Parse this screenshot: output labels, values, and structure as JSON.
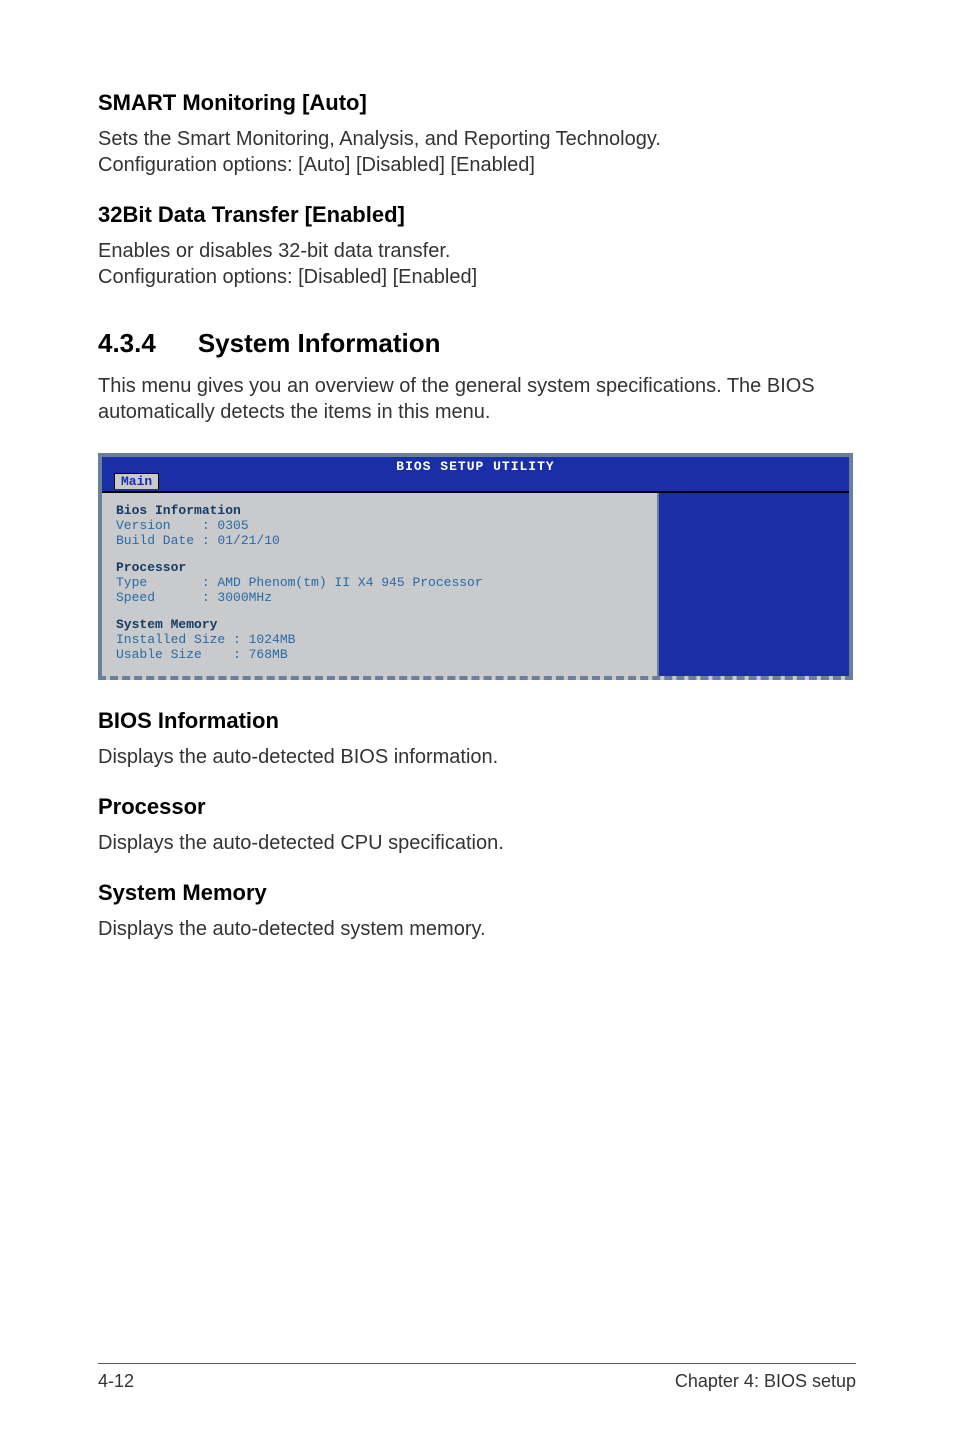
{
  "section1": {
    "heading": "SMART Monitoring [Auto]",
    "p1": "Sets the Smart Monitoring, Analysis, and Reporting Technology.",
    "p2": "Configuration options: [Auto] [Disabled] [Enabled]"
  },
  "section2": {
    "heading": "32Bit Data Transfer [Enabled]",
    "p1": "Enables or disables 32-bit data transfer.",
    "p2": "Configuration options: [Disabled] [Enabled]"
  },
  "section3": {
    "num": "4.3.4",
    "title": "System Information",
    "p1": "This menu gives you an overview of the general system specifications. The BIOS automatically detects the items in this menu."
  },
  "bios": {
    "title": "BIOS SETUP UTILITY",
    "tab": "Main",
    "block1": {
      "head": "Bios Information",
      "l1": "Version    : 0305",
      "l2": "Build Date : 01/21/10"
    },
    "block2": {
      "head": "Processor",
      "l1": "Type       : AMD Phenom(tm) II X4 945 Processor",
      "l2": "Speed      : 3000MHz"
    },
    "block3": {
      "head": "System Memory",
      "l1": "Installed Size : 1024MB",
      "l2": "Usable Size    : 768MB"
    }
  },
  "after": {
    "h1": "BIOS Information",
    "p1": "Displays the auto-detected BIOS information.",
    "h2": "Processor",
    "p2": "Displays the auto-detected CPU specification.",
    "h3": "System Memory",
    "p3": "Displays the auto-detected system memory."
  },
  "footer": {
    "left": "4-12",
    "right": "Chapter 4: BIOS setup"
  }
}
